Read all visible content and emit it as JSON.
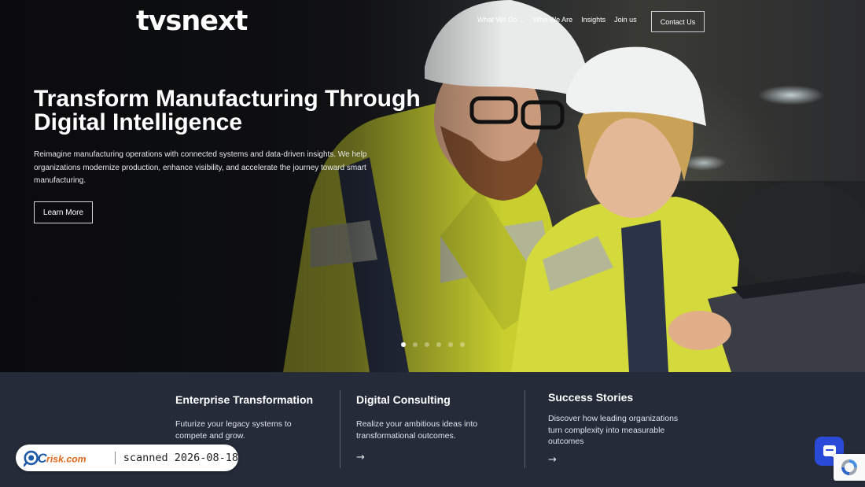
{
  "brand": {
    "logo_text": "tvsnext"
  },
  "nav": {
    "items": [
      {
        "label": "What We Do",
        "has_dropdown": true
      },
      {
        "label": "Who We Are"
      },
      {
        "label": "Insights"
      },
      {
        "label": "Join us"
      }
    ],
    "contact_label": "Contact Us"
  },
  "hero": {
    "title": "Transform Manufacturing Through Digital Intelligence",
    "description": "Reimagine manufacturing operations with connected systems and data-driven insights. We help organizations modernize production, enhance visibility, and accelerate the journey toward smart manufacturing.",
    "cta_label": "Learn More",
    "slider": {
      "count": 6,
      "active_index": 0
    }
  },
  "cards": [
    {
      "title": "Enterprise Transformation",
      "text": "Futurize your legacy systems to compete and grow."
    },
    {
      "title": "Digital Consulting",
      "text": "Realize your ambitious ideas into transformational outcomes.",
      "arrow": "→"
    },
    {
      "title": "Success Stories",
      "text": "Discover how leading organizations turn complexity into measurable outcomes",
      "arrow": "→"
    }
  ],
  "overlay": {
    "brand": "PCrisk.com",
    "scan_text": "scanned 2026-08-18"
  },
  "colors": {
    "chat_button": "#2a4ad8",
    "section_bg": "#252b39",
    "safety_yellow": "#d6dc3a"
  },
  "icons": {
    "chat": "chat-bubble-icon",
    "recaptcha": "recaptcha-icon",
    "arrow": "arrow-right-icon",
    "dropdown": "chevron-down-icon"
  }
}
